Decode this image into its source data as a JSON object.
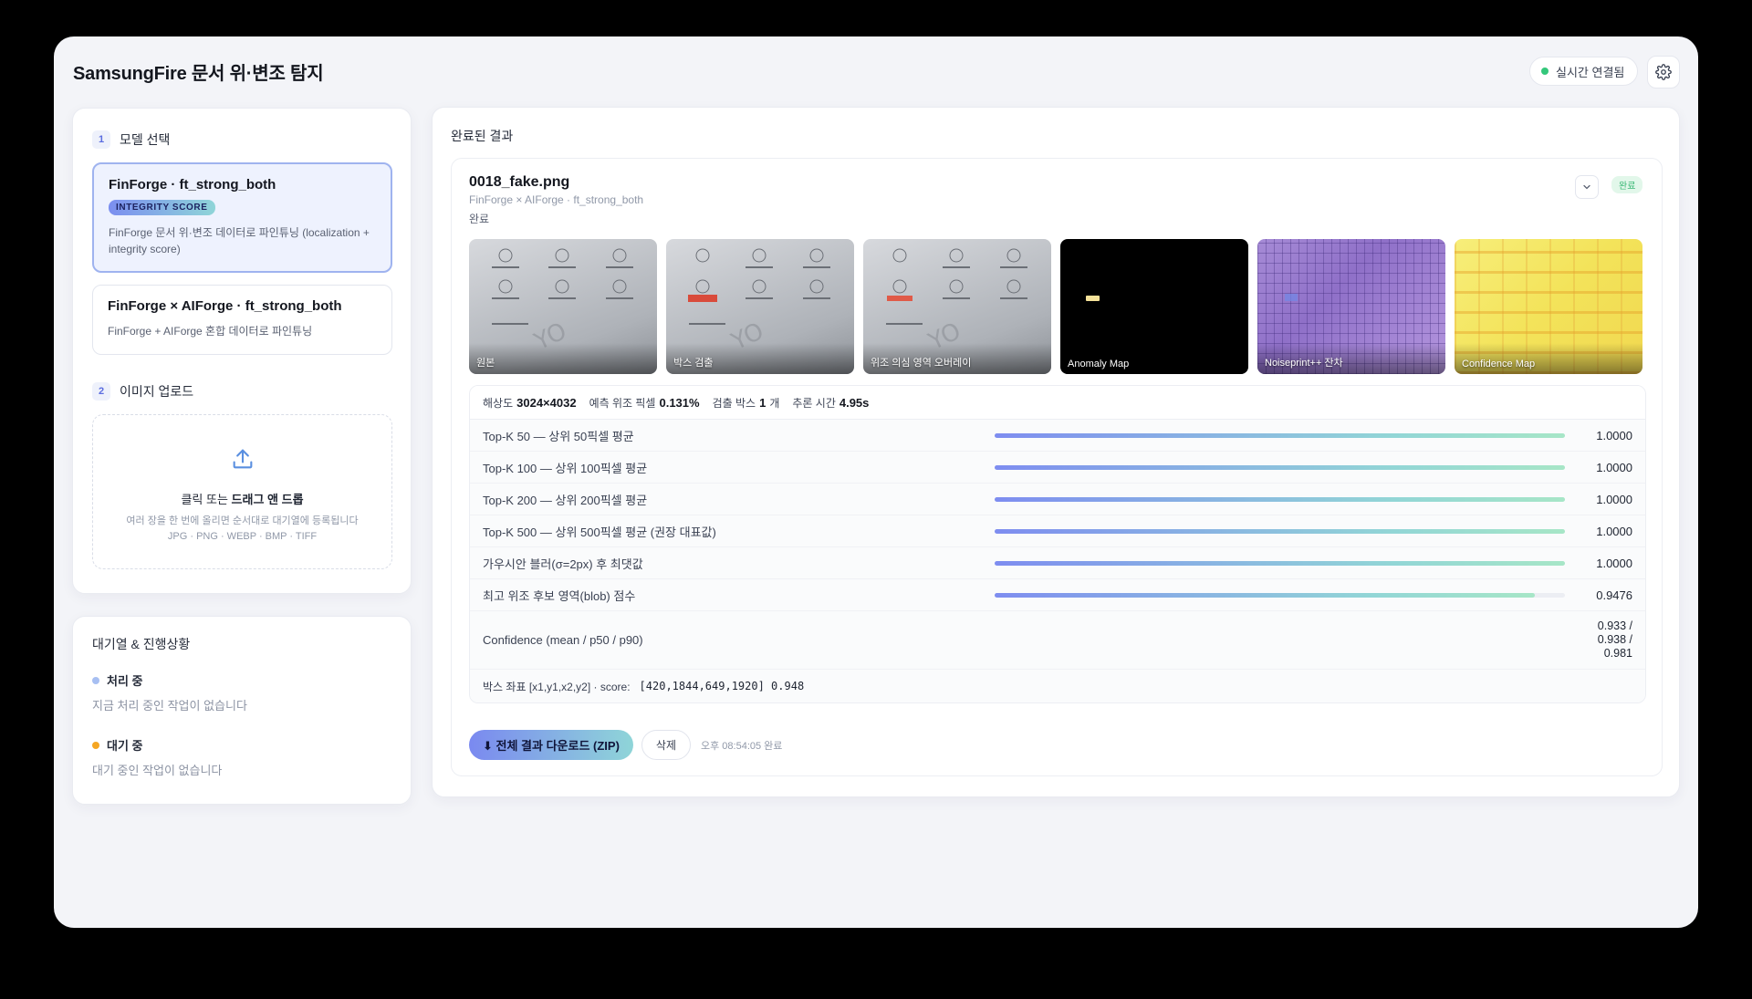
{
  "app": {
    "title": "SamsungFire 문서 위·변조 탐지",
    "connection_status": "실시간 연결됨"
  },
  "colors": {
    "accent": "#5b6de0",
    "status_green": "#34c77b",
    "pending_orange": "#f5a623",
    "processing_blue": "#a7bff2"
  },
  "model_section": {
    "step": "1",
    "title": "모델 선택",
    "models": [
      {
        "name": "FinForge · ft_strong_both",
        "badge": "INTEGRITY SCORE",
        "description": "FinForge 문서 위·변조 데이터로 파인튜닝 (localization + integrity score)",
        "selected": true
      },
      {
        "name": "FinForge × AIForge · ft_strong_both",
        "badge": "",
        "description": "FinForge + AIForge 혼합 데이터로 파인튜닝",
        "selected": false
      }
    ]
  },
  "upload_section": {
    "step": "2",
    "title": "이미지 업로드",
    "prompt_prefix": "클릭 또는",
    "prompt_strong": "드래그 앤 드롭",
    "hint": "여러 장을 한 번에 올리면 순서대로 대기열에 등록됩니다",
    "formats": "JPG · PNG · WEBP · BMP · TIFF"
  },
  "queue": {
    "title": "대기열 & 진행상황",
    "processing_label": "처리 중",
    "processing_empty": "지금 처리 중인 작업이 없습니다",
    "waiting_label": "대기 중",
    "waiting_empty": "대기 중인 작업이 없습니다"
  },
  "results": {
    "title": "완료된 결과",
    "item": {
      "file_name": "0018_fake.png",
      "model": "FinForge × AIForge · ft_strong_both",
      "status": "완료",
      "badge": "완료",
      "thumbnails": [
        "원본",
        "박스 검출",
        "위조 의심 영역 오버레이",
        "Anomaly Map",
        "Noiseprint++ 잔차",
        "Confidence Map"
      ],
      "summary": {
        "resolution_label": "해상도",
        "resolution": "3024×4032",
        "forged_label": "예측 위조 픽셀",
        "forged": "0.131%",
        "boxes_label": "검출 박스",
        "boxes": "1",
        "boxes_unit": "개",
        "time_label": "추론 시간",
        "time": "4.95s"
      },
      "metrics": [
        {
          "label": "Top-K 50 — 상위 50픽셀 평균",
          "value": "1.0000",
          "fill": 1.0
        },
        {
          "label": "Top-K 100 — 상위 100픽셀 평균",
          "value": "1.0000",
          "fill": 1.0
        },
        {
          "label": "Top-K 200 — 상위 200픽셀 평균",
          "value": "1.0000",
          "fill": 1.0
        },
        {
          "label": "Top-K 500 — 상위 500픽셀 평균 (권장 대표값)",
          "value": "1.0000",
          "fill": 1.0
        },
        {
          "label": "가우시안 블러(σ=2px) 후 최댓값",
          "value": "1.0000",
          "fill": 1.0
        },
        {
          "label": "최고 위조 후보 영역(blob) 점수",
          "value": "0.9476",
          "fill": 0.9476
        }
      ],
      "confidence": {
        "label": "Confidence (mean / p50 / p90)",
        "line1": "0.933 /",
        "line2": "0.938 /",
        "line3": "0.981"
      },
      "box_coords": {
        "label": "박스 좌표 [x1,y1,x2,y2] · score:",
        "value": "[420,1844,649,1920] 0.948"
      },
      "download_label": "⬇ 전체 결과 다운로드 (ZIP)",
      "delete_label": "삭제",
      "completed_time": "오후 08:54:05 완료"
    }
  }
}
